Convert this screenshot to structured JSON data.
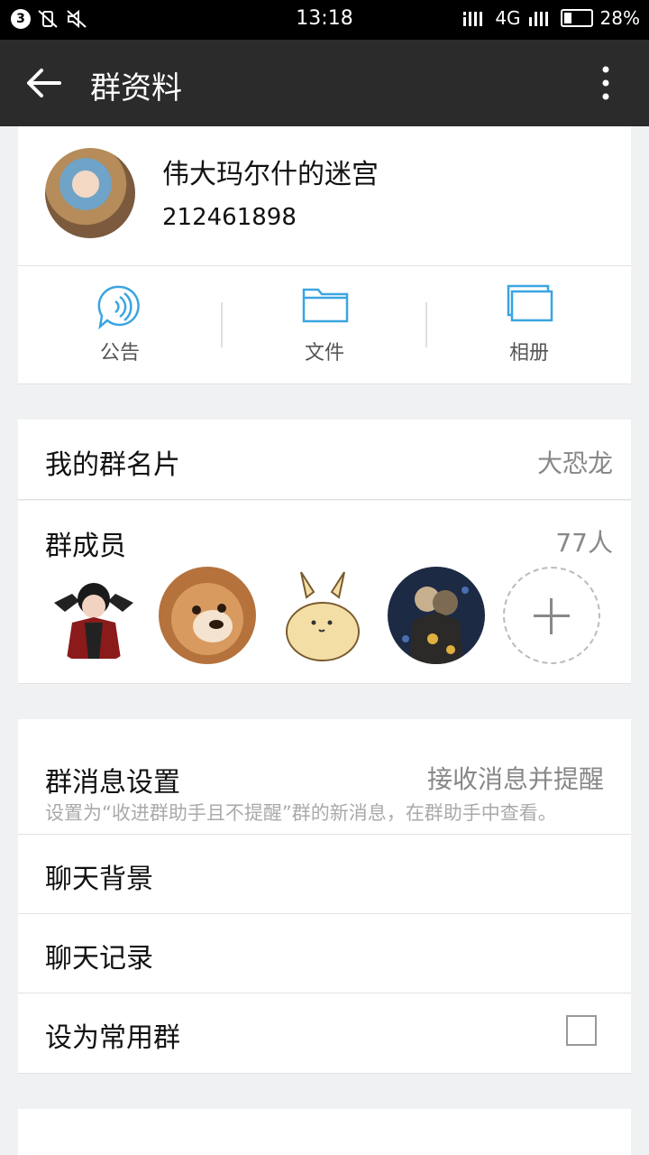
{
  "status_bar": {
    "notification_count": "3",
    "time": "13:18",
    "network": "4G",
    "battery": "28%",
    "battery_level": 0.28
  },
  "header": {
    "title": "群资料"
  },
  "group": {
    "name": "伟大玛尔什的迷宫",
    "id": "212461898"
  },
  "tools": [
    {
      "label": "公告",
      "icon": "announcement-icon"
    },
    {
      "label": "文件",
      "icon": "folder-icon"
    },
    {
      "label": "相册",
      "icon": "album-icon"
    }
  ],
  "my_card": {
    "label": "我的群名片",
    "value": "大恐龙"
  },
  "members": {
    "label": "群成员",
    "count": "77人"
  },
  "message_settings": {
    "label": "群消息设置",
    "value": "接收消息并提醒",
    "hint": "设置为“收进群助手且不提醒”群的新消息，在群助手中查看。"
  },
  "chat_background": {
    "label": "聊天背景"
  },
  "chat_history": {
    "label": "聊天记录"
  },
  "set_common": {
    "label": "设为常用群",
    "checked": false
  },
  "colors": {
    "accent": "#3aa5e0",
    "titlebar": "#2b2b2b"
  }
}
